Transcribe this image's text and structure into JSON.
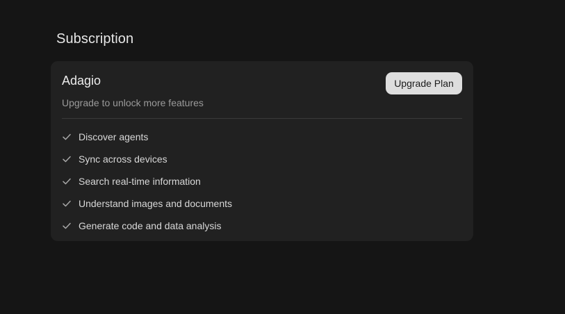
{
  "section": {
    "title": "Subscription"
  },
  "plan": {
    "name": "Adagio",
    "subtitle": "Upgrade to unlock more features",
    "upgrade_label": "Upgrade Plan"
  },
  "features": [
    {
      "label": "Discover agents",
      "icon": "check-icon"
    },
    {
      "label": "Sync across devices",
      "icon": "check-icon"
    },
    {
      "label": "Search real-time information",
      "icon": "check-icon"
    },
    {
      "label": "Understand images and documents",
      "icon": "check-icon"
    },
    {
      "label": "Generate code and data analysis",
      "icon": "check-icon"
    }
  ],
  "colors": {
    "background": "#151515",
    "card": "#212121",
    "button": "#dedede",
    "check": "#a8a8a8"
  }
}
